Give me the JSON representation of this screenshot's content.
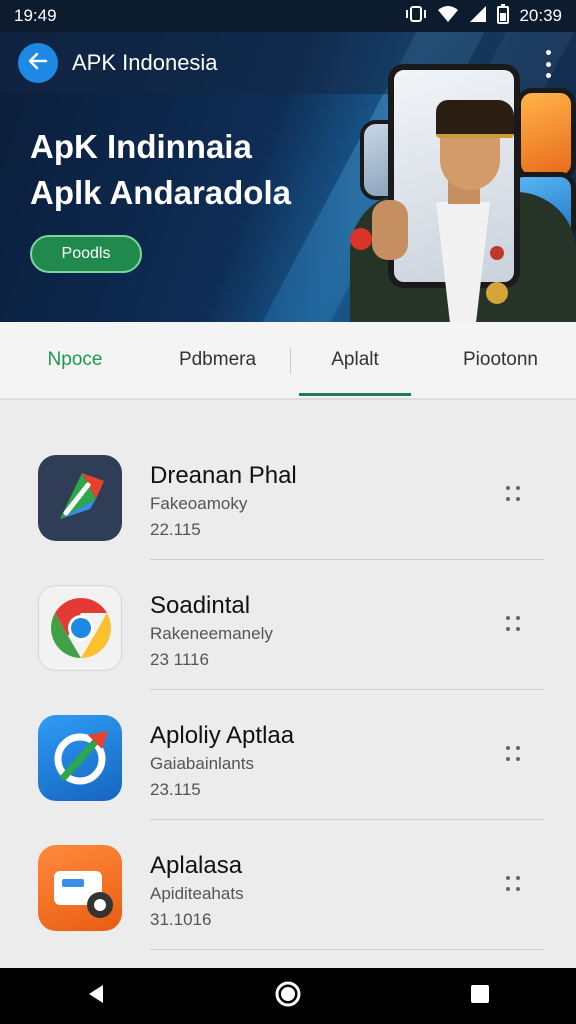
{
  "status_bar": {
    "time_left": "19:49",
    "time_right": "20:39",
    "icons": [
      "vibrate-icon",
      "wifi-icon",
      "signal-icon",
      "battery-icon"
    ]
  },
  "app_bar": {
    "title": "APK Indonesia",
    "back_icon": "back-arrow-icon",
    "menu_icon": "more-vert-icon"
  },
  "hero": {
    "title_line1": "ApK Indinnaia",
    "title_line2": "Aplk Andaradola",
    "button_label": "Poodls"
  },
  "tabs": [
    {
      "label": "Npoce",
      "active": false,
      "color": "#1e9b4f"
    },
    {
      "label": "Pdbmera",
      "active": false
    },
    {
      "label": "Aplalt",
      "active": true
    },
    {
      "label": "Piootonn",
      "active": false
    }
  ],
  "apps": [
    {
      "title": "Dreanan Phal",
      "subtitle": "Fakeoamoky",
      "version": "22.115",
      "icon": "navigation-arrow-icon"
    },
    {
      "title": "Soadintal",
      "subtitle": "Rakeneemanely",
      "version": "23 1116",
      "icon": "chrome-icon"
    },
    {
      "title": "Aploliy Aptlaa",
      "subtitle": "Gaiabainlants",
      "version": "23.115",
      "icon": "refresh-arrow-icon"
    },
    {
      "title": "Aplalasa",
      "subtitle": "Apiditeahats",
      "version": "31.1016",
      "icon": "settings-gear-icon"
    }
  ],
  "colors": {
    "accent_blue": "#1e88e5",
    "accent_green": "#1e9b4f",
    "tab_indicator": "#1f7a5a",
    "hero_bg": "#0e2d55"
  }
}
